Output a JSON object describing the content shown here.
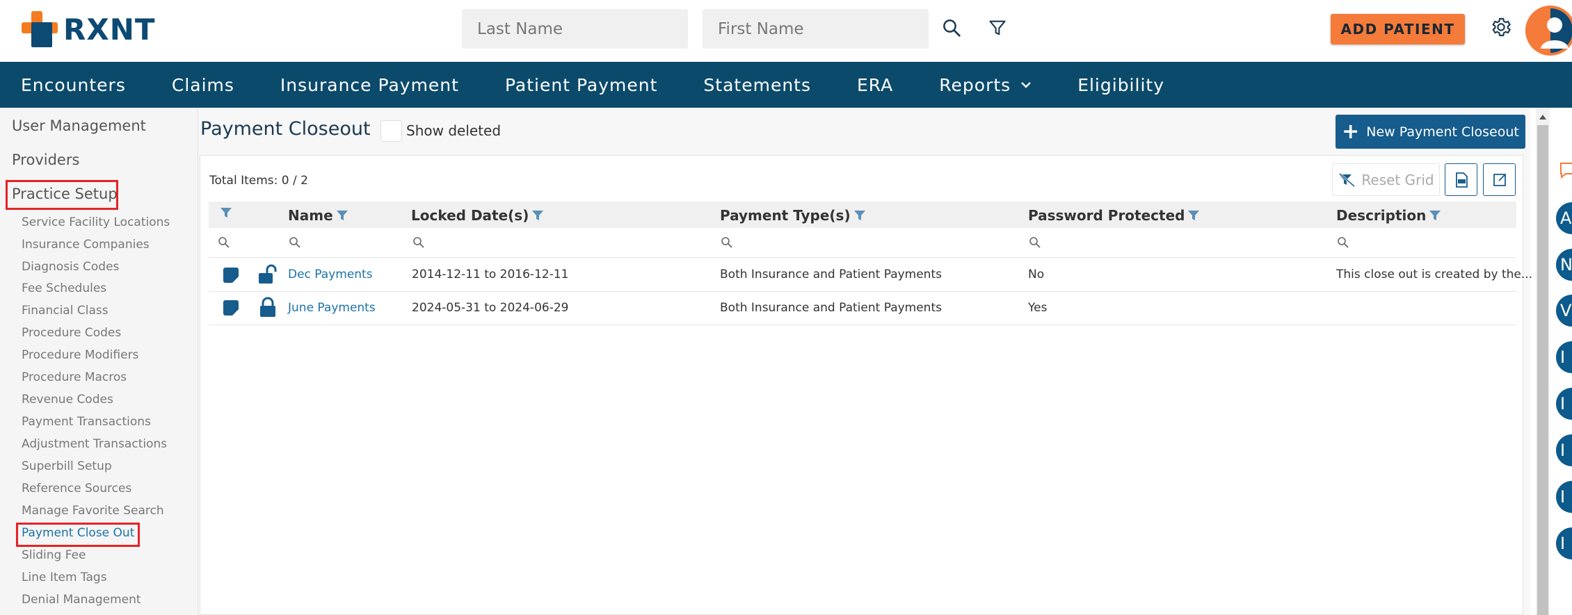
{
  "header": {
    "logo_text": "RXNT",
    "last_name_placeholder": "Last Name",
    "first_name_placeholder": "First Name",
    "add_patient_label": "ADD PATIENT"
  },
  "nav": {
    "items": [
      "Encounters",
      "Claims",
      "Insurance Payment",
      "Patient Payment",
      "Statements",
      "ERA",
      "Reports",
      "Eligibility"
    ]
  },
  "sidebar": {
    "top_items": [
      "User Management",
      "Providers",
      "Practice Setup"
    ],
    "sub_items": [
      "Service Facility Locations",
      "Insurance Companies",
      "Diagnosis Codes",
      "Fee Schedules",
      "Financial Class",
      "Procedure Codes",
      "Procedure Modifiers",
      "Procedure Macros",
      "Revenue Codes",
      "Payment Transactions",
      "Adjustment Transactions",
      "Superbill Setup",
      "Reference Sources",
      "Manage Favorite Search",
      "Payment Close Out",
      "Sliding Fee",
      "Line Item Tags",
      "Denial Management"
    ]
  },
  "page": {
    "title": "Payment Closeout",
    "show_deleted_label": "Show deleted",
    "new_button_label": "New Payment Closeout",
    "total_items": "Total Items: 0 / 2",
    "reset_grid_label": "Reset Grid"
  },
  "grid": {
    "columns": [
      "Name",
      "Locked Date(s)",
      "Payment Type(s)",
      "Password Protected",
      "Description"
    ],
    "rows": [
      {
        "name": "Dec Payments",
        "locked_dates": "2014-12-11 to 2016-12-11",
        "payment_types": "Both Insurance and Patient Payments",
        "password_protected": "No",
        "description": "This close out is created by the..."
      },
      {
        "name": "June Payments",
        "locked_dates": "2024-05-31 to 2024-06-29",
        "payment_types": "Both Insurance and Patient Payments",
        "password_protected": "Yes",
        "description": ""
      }
    ]
  },
  "right_bubbles": [
    "A",
    "N",
    "V",
    "I",
    "I",
    "I",
    "I",
    "I"
  ],
  "colors": {
    "brand_navy": "#0b4a6b",
    "brand_orange": "#f47b3a",
    "link_blue": "#1a73a8",
    "highlight_red": "#e52326"
  }
}
